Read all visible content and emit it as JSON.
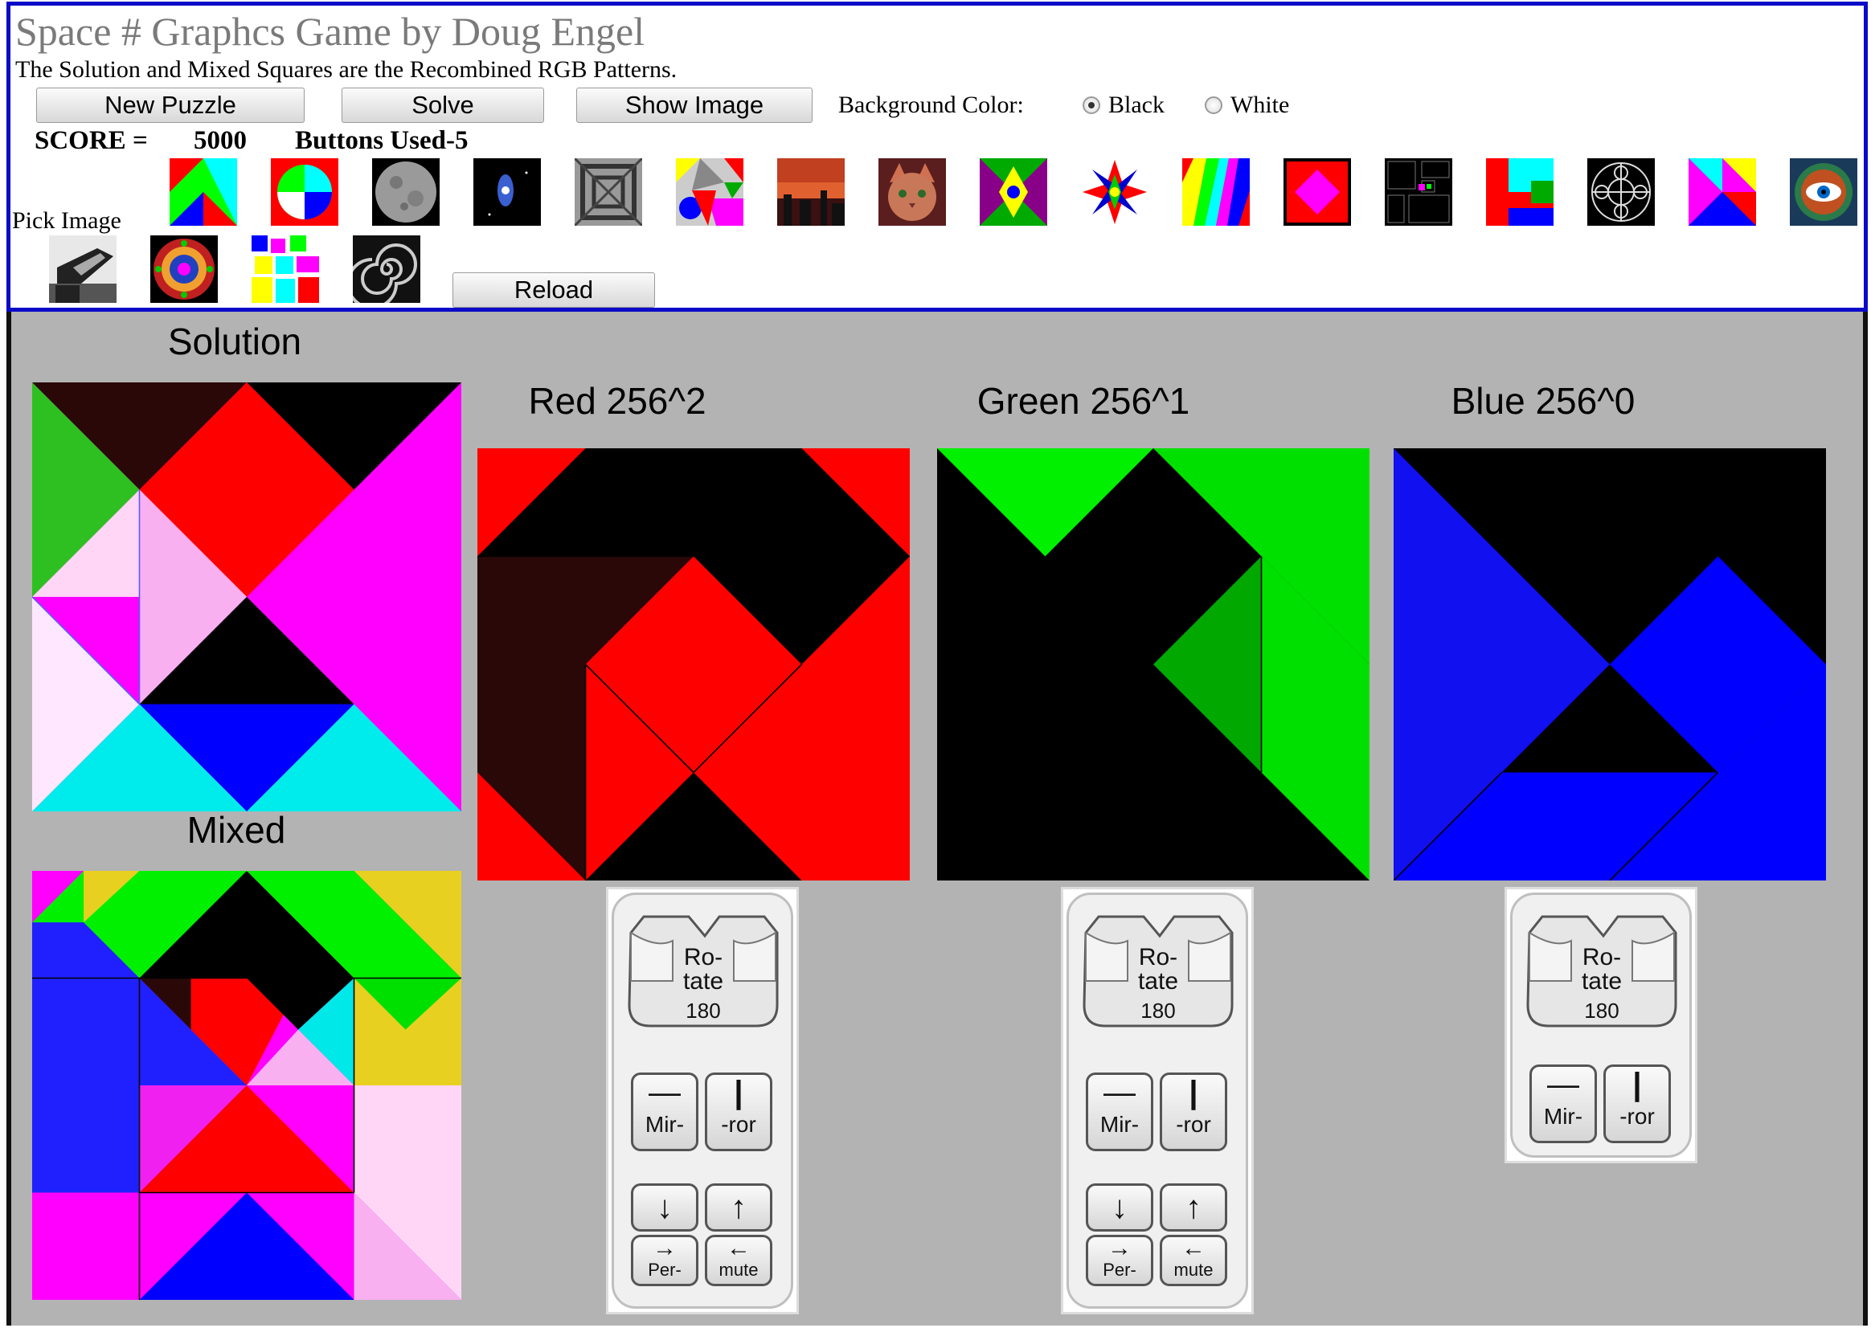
{
  "header": {
    "title": "Space # Graphcs Game by Doug Engel",
    "subtitle": "The Solution and Mixed Squares are the Recombined RGB Patterns.",
    "buttons": {
      "new_puzzle": "New Puzzle",
      "solve": "Solve",
      "show_image": "Show Image",
      "reload": "Reload"
    },
    "background_label": "Background Color:",
    "background_options": [
      {
        "label": "Black",
        "selected": true
      },
      {
        "label": "White",
        "selected": false
      }
    ],
    "score_label": "SCORE =",
    "score_value": "5000",
    "buttons_used": "Buttons Used-5",
    "pick_image_label": "Pick Image"
  },
  "panels": {
    "solution_title": "Solution",
    "mixed_title": "Mixed",
    "red_title": "Red 256^2",
    "green_title": "Green 256^1",
    "blue_title": "Blue 256^0"
  },
  "controls": {
    "rotate_line1": "Ro-",
    "rotate_line2": "tate",
    "rotate_degrees": "180",
    "mirror_left": "Mir-",
    "mirror_right": "-ror",
    "mirror_left_symbol": "—",
    "mirror_right_symbol": "|",
    "permute_down": "↓",
    "permute_up": "↑",
    "permute_right_arrow": "→",
    "permute_left_arrow": "←",
    "permute_left": "Per-",
    "permute_right": "mute"
  },
  "colors": {
    "header_border": "#0a0ac8",
    "game_background": "#b3b3b3",
    "red": "#ff0000",
    "green": "#00e000",
    "blue": "#0000ff"
  },
  "thumbnails": [
    "tangram-thumbnail",
    "circle-tangram-thumbnail",
    "moon-thumbnail",
    "galaxy-thumbnail",
    "moire-pattern-thumbnail",
    "colored-mosaic-thumbnail",
    "sunset-city-thumbnail",
    "cat-thumbnail",
    "kaleidoscope-thumbnail",
    "star-burst-thumbnail",
    "rainbow-stripes-thumbnail",
    "red-diamond-thumbnail",
    "black-tiles-thumbnail",
    "color-blocks-thumbnail",
    "circle-ornament-thumbnail",
    "triangle-tangram-thumbnail",
    "eye-mandala-thumbnail",
    "penguin-statue-thumbnail",
    "rose-window-thumbnail",
    "pastel-squares-thumbnail",
    "spiral-thumbnail"
  ]
}
